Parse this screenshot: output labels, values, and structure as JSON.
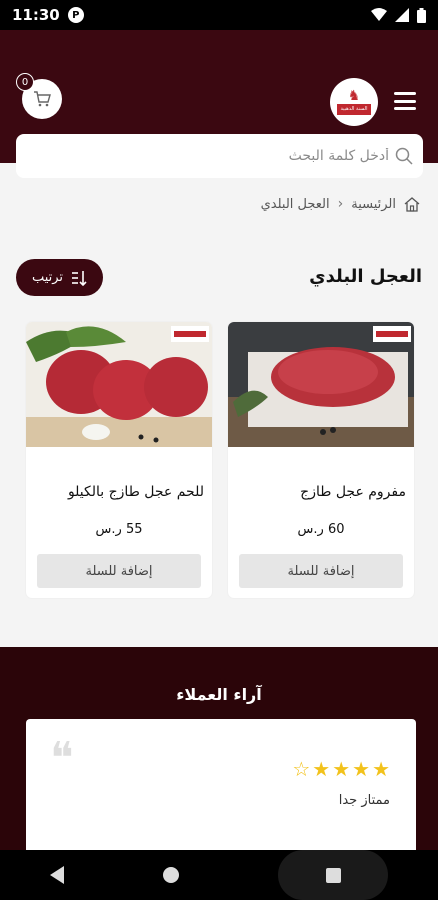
{
  "status_bar": {
    "time": "11:30",
    "notification_icon": "P"
  },
  "header": {
    "cart_count": "0",
    "logo_text": "السنة الذهبية",
    "search_placeholder": "أدخل كلمة البحث"
  },
  "breadcrumb": {
    "home": "الرئيسية",
    "current": "العجل البلدي"
  },
  "category": {
    "title": "العجل البلدي",
    "sort_label": "ترتيب"
  },
  "products": [
    {
      "name": "مفروم عجل طازج",
      "price": "60 ر.س",
      "add_label": "إضافة للسلة"
    },
    {
      "name": "للحم عجل طازج بالكيلو",
      "price": "55 ر.س",
      "add_label": "إضافة للسلة"
    }
  ],
  "reviews": {
    "title": "آراء العملاء",
    "items": [
      {
        "rating": 4,
        "max": 5,
        "text": "ممتاز جدا"
      }
    ]
  },
  "colors": {
    "brand": "#3b0811",
    "dark": "#2b0509",
    "star": "#f2c21c"
  }
}
